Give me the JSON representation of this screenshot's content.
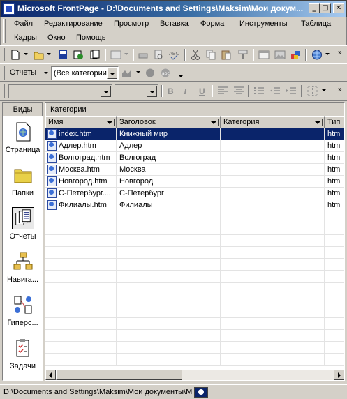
{
  "window": {
    "title": "Microsoft FrontPage - D:\\Documents and Settings\\Maksim\\Мои докум...",
    "minimize": "_",
    "maximize": "□",
    "close": "✕"
  },
  "menu": [
    "Файл",
    "Редактирование",
    "Просмотр",
    "Вставка",
    "Формат",
    "Инструменты",
    "Таблица",
    "Кадры",
    "Окно",
    "Помощь"
  ],
  "reports_toolbar": {
    "label": "Отчеты",
    "category_value": "(Все категории)"
  },
  "format_toolbar": {
    "style_value": "",
    "font_value": "",
    "bold": "B",
    "italic": "I",
    "underline": "U"
  },
  "views": {
    "header": "Виды",
    "items": [
      {
        "label": "Страница",
        "icon": "page-view-icon"
      },
      {
        "label": "Папки",
        "icon": "folders-view-icon"
      },
      {
        "label": "Отчеты",
        "icon": "reports-view-icon",
        "active": true
      },
      {
        "label": "Навига...",
        "icon": "navigation-view-icon"
      },
      {
        "label": "Гиперс...",
        "icon": "hyperlinks-view-icon"
      },
      {
        "label": "Задачи",
        "icon": "tasks-view-icon"
      }
    ]
  },
  "report": {
    "title": "Категории",
    "columns": [
      "Имя",
      "Заголовок",
      "Категория",
      "Тип"
    ],
    "rows": [
      {
        "name": "index.htm",
        "title": "Книжный мир",
        "category": "",
        "type": "htm",
        "selected": true
      },
      {
        "name": "Адлер.htm",
        "title": "Адлер",
        "category": "",
        "type": "htm"
      },
      {
        "name": "Волгоград.htm",
        "title": "Волгоград",
        "category": "",
        "type": "htm"
      },
      {
        "name": "Москва.htm",
        "title": "Москва",
        "category": "",
        "type": "htm"
      },
      {
        "name": "Новгород.htm",
        "title": "Новгород",
        "category": "",
        "type": "htm"
      },
      {
        "name": "С-Петербург....",
        "title": "С-Петербург",
        "category": "",
        "type": "htm"
      },
      {
        "name": "Филиалы.htm",
        "title": "Филиалы",
        "category": "",
        "type": "htm"
      }
    ]
  },
  "status": {
    "path": "D:\\Documents and Settings\\Maksim\\Мои документы\\Мо"
  },
  "colors": {
    "selection": "#0a246a",
    "titlebar_start": "#0a246a",
    "titlebar_end": "#a6caf0",
    "chrome": "#d4d0c8"
  }
}
